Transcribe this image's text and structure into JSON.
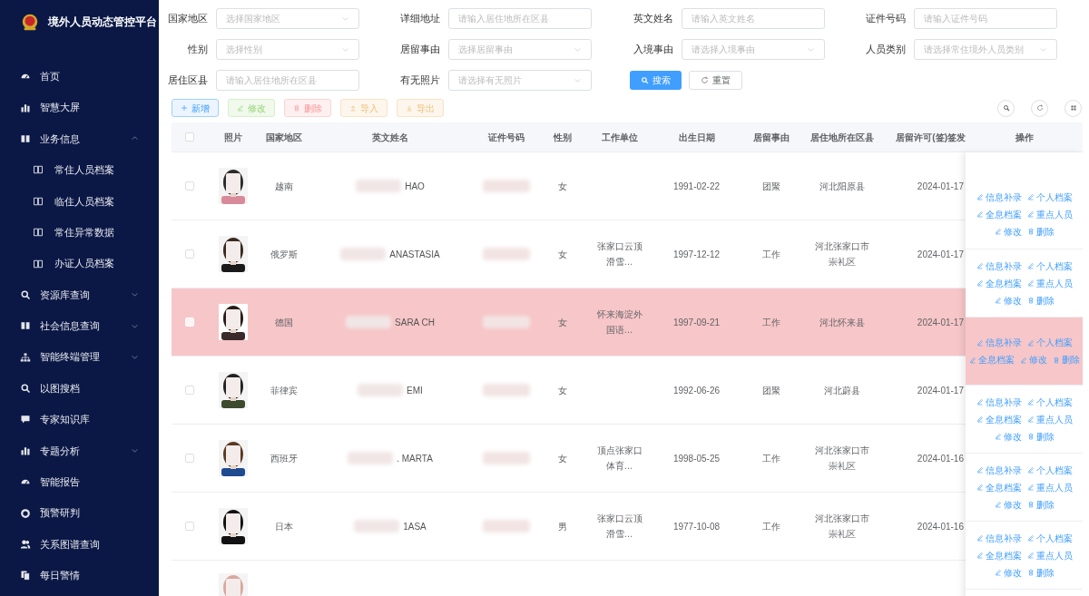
{
  "app": {
    "title": "境外人员动态管控平台"
  },
  "sidebar": {
    "items": [
      {
        "label": "首页"
      },
      {
        "label": "智慧大屏"
      },
      {
        "label": "业务信息",
        "expanded": true,
        "children": [
          {
            "label": "常住人员档案"
          },
          {
            "label": "临住人员档案"
          },
          {
            "label": "常住异常数据"
          },
          {
            "label": "办证人员档案"
          }
        ]
      },
      {
        "label": "资源库查询",
        "expanded": false
      },
      {
        "label": "社会信息查询",
        "expanded": false
      },
      {
        "label": "智能终端管理",
        "expanded": false
      },
      {
        "label": "以图搜档"
      },
      {
        "label": "专家知识库"
      },
      {
        "label": "专题分析",
        "expanded": false
      },
      {
        "label": "智能报告"
      },
      {
        "label": "预警研判"
      },
      {
        "label": "关系图谱查询"
      },
      {
        "label": "每日警情"
      }
    ]
  },
  "filters": [
    {
      "label": "国家地区",
      "placeholder": "选择国家地区",
      "kind": "select"
    },
    {
      "label": "详细地址",
      "placeholder": "请输入居住地所在区县",
      "kind": "input"
    },
    {
      "label": "英文姓名",
      "placeholder": "请输入英文姓名",
      "kind": "input"
    },
    {
      "label": "证件号码",
      "placeholder": "请输入证件号码",
      "kind": "input"
    },
    {
      "label": "性别",
      "placeholder": "选择性别",
      "kind": "select"
    },
    {
      "label": "居留事由",
      "placeholder": "选择居留事由",
      "kind": "select"
    },
    {
      "label": "入境事由",
      "placeholder": "请选择入境事由",
      "kind": "select"
    },
    {
      "label": "人员类别",
      "placeholder": "请选择常住境外人员类别",
      "kind": "select"
    },
    {
      "label": "居住区县",
      "placeholder": "请输入居住地所在区县",
      "kind": "input"
    },
    {
      "label": "有无照片",
      "placeholder": "请选择有无照片",
      "kind": "select"
    }
  ],
  "search_button": "搜索",
  "reset_button": "重置",
  "toolbar": [
    {
      "label": "新增",
      "kind": "add"
    },
    {
      "label": "修改",
      "kind": "edit"
    },
    {
      "label": "删除",
      "kind": "delete"
    },
    {
      "label": "导入",
      "kind": "import"
    },
    {
      "label": "导出",
      "kind": "export"
    }
  ],
  "table": {
    "header_checked": false,
    "columns": [
      "照片",
      "国家地区",
      "英文姓名",
      "证件号码",
      "性别",
      "工作单位",
      "出生日期",
      "居留事由",
      "居住地所在区县",
      "居留许可(签)签发",
      "操作"
    ],
    "rows": [
      {
        "checked": false,
        "highlighted": false,
        "country": "越南",
        "name": "HAO",
        "gender": "女",
        "birth": "1991-02-22",
        "reason": "团聚",
        "district": "河北阳原县",
        "permit": "2024-01-17",
        "actions": [
          {
            "label": "信息补录",
            "kind": "edit"
          },
          {
            "label": "个人档案",
            "kind": "edit"
          },
          {
            "label": "全息档案",
            "kind": "edit"
          },
          {
            "label": "重点人员",
            "kind": "edit"
          },
          {
            "label": "修改",
            "kind": "edit"
          },
          {
            "label": "删除",
            "kind": "delete"
          }
        ]
      },
      {
        "checked": false,
        "highlighted": false,
        "country": "俄罗斯",
        "name": "ANASTASIA",
        "gender": "女",
        "work": "张家口云顶滑雪…",
        "birth": "1997-12-12",
        "reason": "工作",
        "district": "河北张家口市崇礼区",
        "permit": "2024-01-17",
        "actions": [
          {
            "label": "信息补录",
            "kind": "edit"
          },
          {
            "label": "个人档案",
            "kind": "edit"
          },
          {
            "label": "全息档案",
            "kind": "edit"
          },
          {
            "label": "重点人员",
            "kind": "edit"
          },
          {
            "label": "修改",
            "kind": "edit"
          },
          {
            "label": "删除",
            "kind": "delete"
          }
        ]
      },
      {
        "checked": false,
        "highlighted": true,
        "country": "德国",
        "name": "SARA CH",
        "gender": "女",
        "work": "怀来海淀外国语…",
        "birth": "1997-09-21",
        "reason": "工作",
        "district": "河北怀来县",
        "permit": "2024-01-17",
        "actions": [
          {
            "label": "信息补录",
            "kind": "edit"
          },
          {
            "label": "个人档案",
            "kind": "edit"
          },
          {
            "label": "全息档案",
            "kind": "edit"
          },
          {
            "label": "修改",
            "kind": "edit"
          },
          {
            "label": "删除",
            "kind": "delete"
          }
        ]
      },
      {
        "checked": false,
        "highlighted": false,
        "country": "菲律宾",
        "name": "EMI",
        "gender": "女",
        "birth": "1992-06-26",
        "reason": "团聚",
        "district": "河北蔚县",
        "permit": "2024-01-17",
        "actions": [
          {
            "label": "信息补录",
            "kind": "edit"
          },
          {
            "label": "个人档案",
            "kind": "edit"
          },
          {
            "label": "全息档案",
            "kind": "edit"
          },
          {
            "label": "重点人员",
            "kind": "edit"
          },
          {
            "label": "修改",
            "kind": "edit"
          },
          {
            "label": "删除",
            "kind": "delete"
          }
        ]
      },
      {
        "checked": false,
        "highlighted": false,
        "country": "西班牙",
        "name": ". MARTA",
        "gender": "女",
        "work": "顶点张家口体育…",
        "birth": "1998-05-25",
        "reason": "工作",
        "district": "河北张家口市崇礼区",
        "permit": "2024-01-16",
        "actions": [
          {
            "label": "信息补录",
            "kind": "edit"
          },
          {
            "label": "个人档案",
            "kind": "edit"
          },
          {
            "label": "全息档案",
            "kind": "edit"
          },
          {
            "label": "重点人员",
            "kind": "edit"
          },
          {
            "label": "修改",
            "kind": "edit"
          },
          {
            "label": "删除",
            "kind": "delete"
          }
        ]
      },
      {
        "checked": false,
        "highlighted": false,
        "country": "日本",
        "name": "1ASA",
        "gender": "男",
        "work": "张家口云顶滑雪…",
        "birth": "1977-10-08",
        "reason": "工作",
        "district": "河北张家口市崇礼区",
        "permit": "2024-01-16",
        "actions": [
          {
            "label": "信息补录",
            "kind": "edit"
          },
          {
            "label": "个人档案",
            "kind": "edit"
          },
          {
            "label": "全息档案",
            "kind": "edit"
          },
          {
            "label": "重点人员",
            "kind": "edit"
          },
          {
            "label": "修改",
            "kind": "edit"
          },
          {
            "label": "删除",
            "kind": "delete"
          }
        ]
      },
      {
        "highlighted": false
      }
    ]
  }
}
